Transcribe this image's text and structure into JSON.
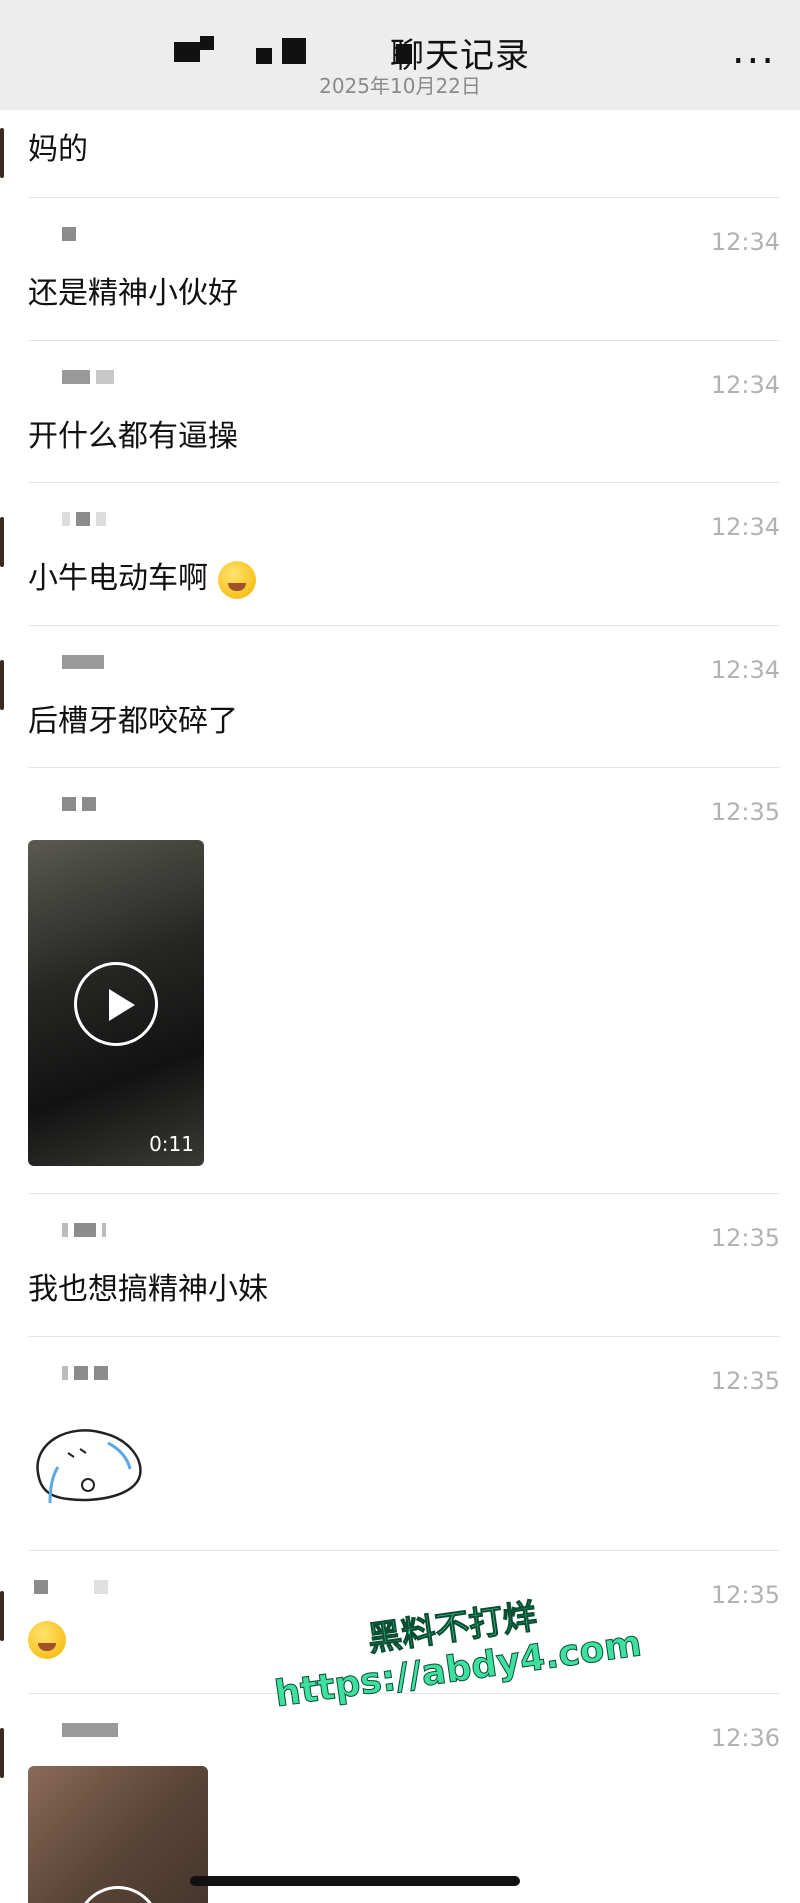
{
  "header": {
    "title": "聊天记录",
    "date": "2025年10月22日",
    "more_icon": "..."
  },
  "messages": [
    {
      "time": "",
      "text": "妈的"
    },
    {
      "time": "12:34",
      "text": "还是精神小伙好"
    },
    {
      "time": "12:34",
      "text": "开什么都有逼操"
    },
    {
      "time": "12:34",
      "text": "小牛电动车啊"
    },
    {
      "time": "12:34",
      "text": "后槽牙都咬碎了"
    },
    {
      "time": "12:35",
      "text": "",
      "video_duration": "0:11"
    },
    {
      "time": "12:35",
      "text": "我也想搞精神小妹"
    },
    {
      "time": "12:35",
      "text": ""
    },
    {
      "time": "12:35",
      "text": ""
    },
    {
      "time": "12:36",
      "text": ""
    }
  ],
  "watermark": {
    "line1": "黑料不打烊",
    "line2": "https://abdy4.com"
  }
}
